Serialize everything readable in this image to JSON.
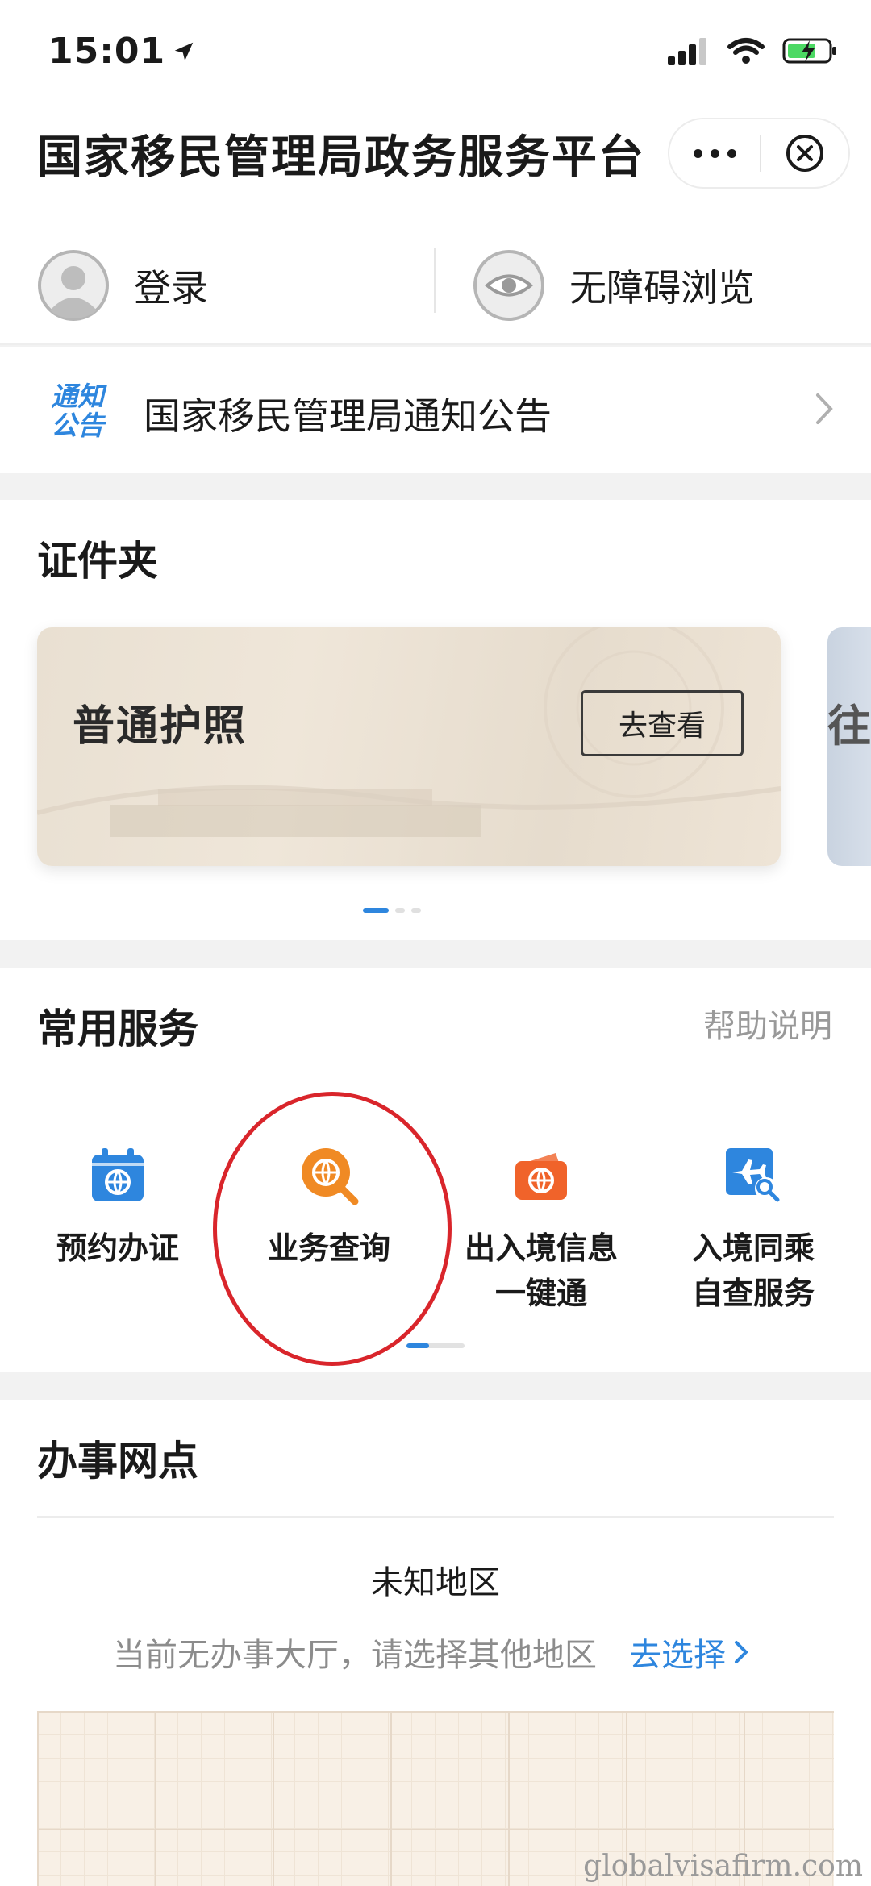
{
  "status_bar": {
    "time": "15:01"
  },
  "header": {
    "title": "国家移民管理局政务服务平台"
  },
  "account": {
    "login_label": "登录",
    "accessibility_label": "无障碍浏览"
  },
  "notice": {
    "badge_line1": "通知",
    "badge_line2": "公告",
    "text": "国家移民管理局通知公告"
  },
  "documents": {
    "title": "证件夹",
    "cards": [
      {
        "name": "普通护照",
        "action": "去查看"
      },
      {
        "name": "往",
        "action": ""
      }
    ]
  },
  "services": {
    "title": "常用服务",
    "help": "帮助说明",
    "items": [
      {
        "label": "预约办证",
        "icon": "calendar-globe-icon",
        "color": "#2e86de"
      },
      {
        "label": "业务查询",
        "icon": "globe-search-icon",
        "color": "#f08a24"
      },
      {
        "label": "出入境信息\n一键通",
        "icon": "wallet-globe-icon",
        "color": "#f0632a"
      },
      {
        "label": "入境同乘\n自查服务",
        "icon": "plane-search-icon",
        "color": "#2e86de"
      }
    ]
  },
  "offices": {
    "title": "办事网点",
    "region": "未知地区",
    "hint": "当前无办事大厅，请选择其他地区",
    "choose": "去选择"
  },
  "watermark": "globalvisafirm.com",
  "colors": {
    "accent": "#2e86de",
    "highlight_ring": "#d9252b",
    "background": "#f2f2f2"
  }
}
